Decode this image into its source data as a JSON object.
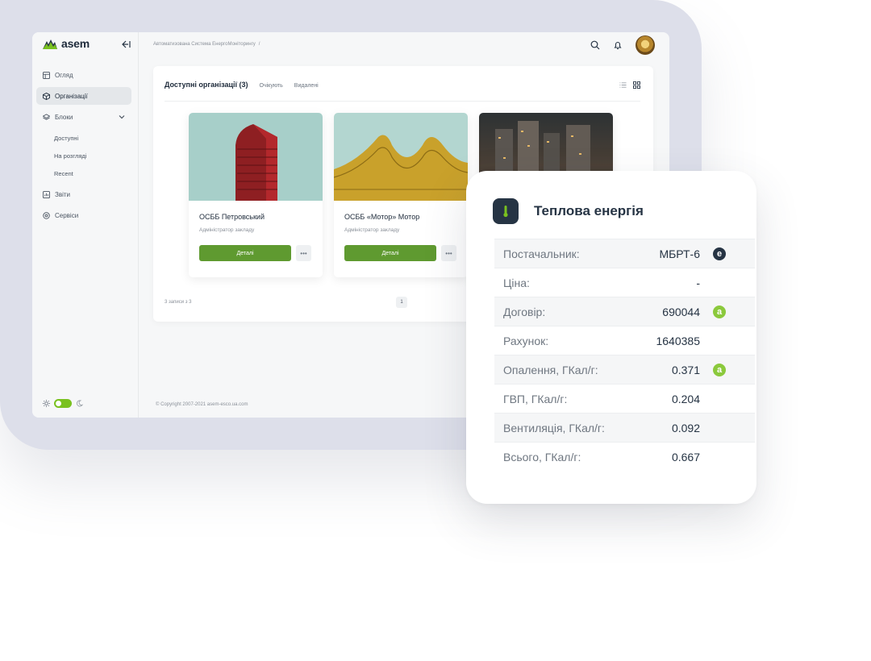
{
  "brand": {
    "logo_text": "asem",
    "accent": "#79c11f",
    "button_color": "#5f9a30",
    "dark": "#263444"
  },
  "sidebar": {
    "items": [
      {
        "label": "Огляд",
        "icon": "layout-icon"
      },
      {
        "label": "Організації",
        "icon": "cube-icon",
        "active": true
      },
      {
        "label": "Блоки",
        "icon": "layers-icon",
        "expanded": true
      },
      {
        "label": "Звіти",
        "icon": "chart-icon"
      },
      {
        "label": "Сервіси",
        "icon": "settings-icon"
      }
    ],
    "sub_items": [
      "Доступні",
      "На розгляді",
      "Recent"
    ]
  },
  "topbar": {
    "breadcrumb": "Автоматизована Система ЕнергоМоніторингу",
    "breadcrumb_sep": "/"
  },
  "panel": {
    "tabs": {
      "main": "Доступні організації (3)",
      "pending": "Очікують",
      "deleted": "Видалені"
    },
    "cards": [
      {
        "title": "ОСББ Петровський",
        "subtitle": "Адміністратор закладу",
        "button": "Деталі",
        "more": "•••"
      },
      {
        "title": "ОСББ «Мотор» Мотор",
        "subtitle": "Адміністратор закладу",
        "button": "Деталі",
        "more": "•••"
      }
    ],
    "records": "3 записи з 3",
    "page": "1"
  },
  "footer": "© Copyright 2007-2021 asem-esco.ua.com",
  "energy": {
    "title": "Теплова енергія",
    "rows": [
      {
        "label": "Постачальник:",
        "value": "МБРТ-6",
        "badge": "e",
        "badge_color": "#263444"
      },
      {
        "label": "Ціна:",
        "value": "-"
      },
      {
        "label": "Договір:",
        "value": "690044",
        "badge": "a",
        "badge_color": "#8bc93c"
      },
      {
        "label": "Рахунок:",
        "value": "1640385"
      },
      {
        "label": "Опалення, ГКал/г:",
        "value": "0.371",
        "badge": "a",
        "badge_color": "#8bc93c"
      },
      {
        "label": "ГВП, ГКал/г:",
        "value": "0.204"
      },
      {
        "label": "Вентиляція, ГКал/г:",
        "value": "0.092"
      },
      {
        "label": "Всього, ГКал/г:",
        "value": "0.667"
      }
    ]
  }
}
